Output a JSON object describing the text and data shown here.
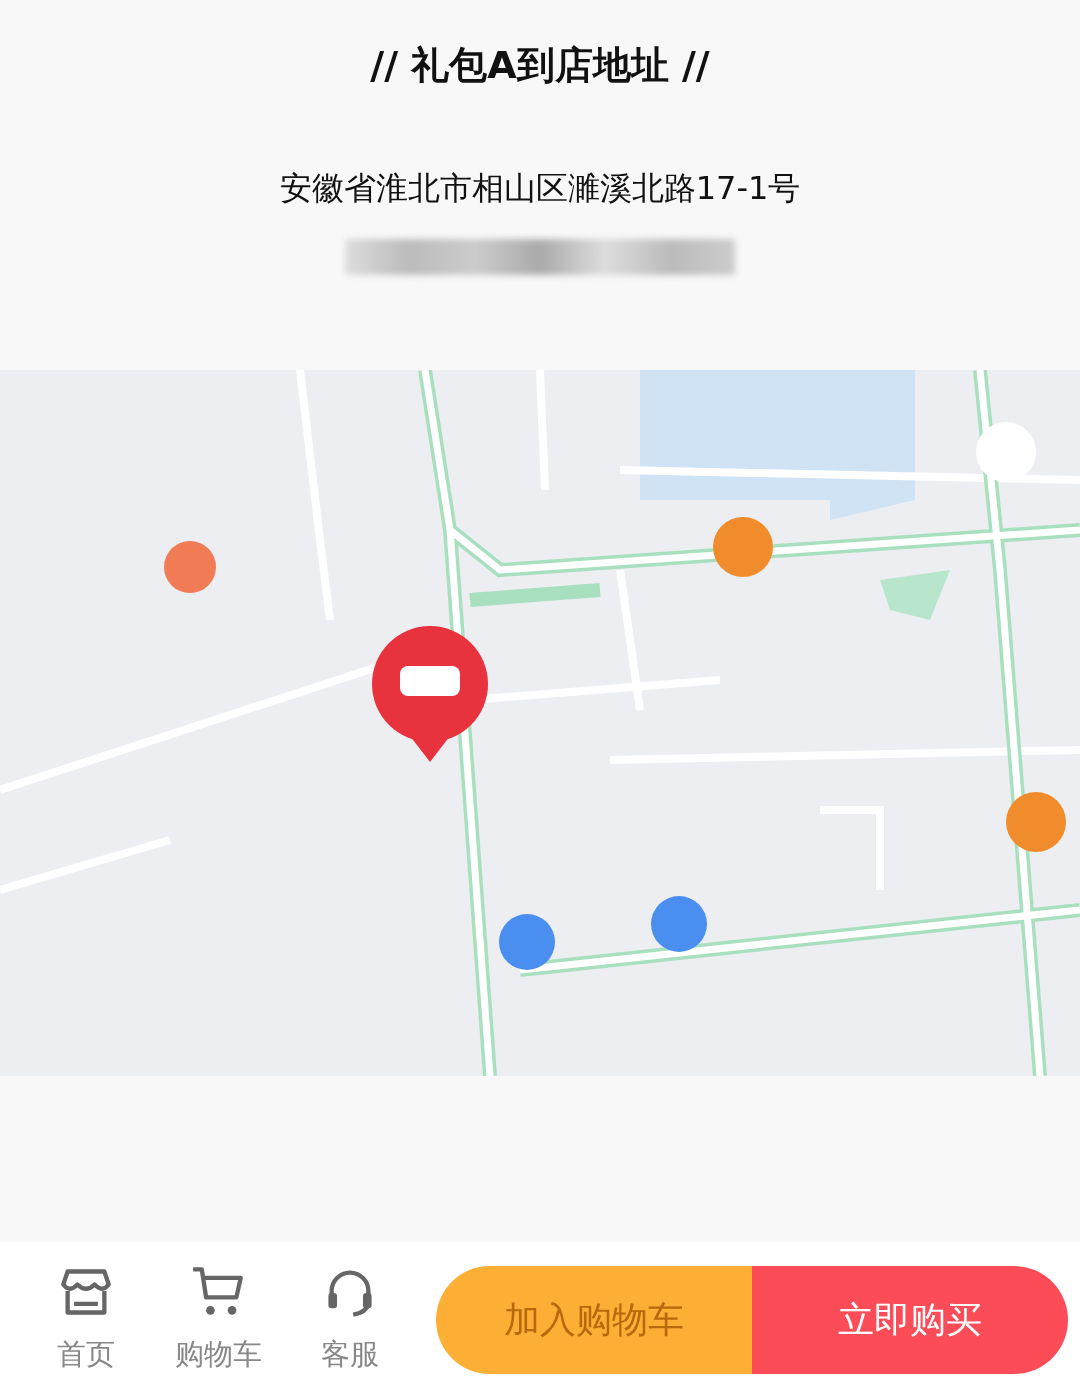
{
  "section": {
    "title": "// 礼包A到店地址 //",
    "address": "安徽省淮北市相山区濉溪北路17-1号"
  },
  "bottom_bar": {
    "nav": [
      {
        "label": "首页"
      },
      {
        "label": "购物车"
      },
      {
        "label": "客服"
      }
    ],
    "actions": [
      {
        "label": "加入购物车",
        "kind": "cart"
      },
      {
        "label": "立即购买",
        "kind": "buy"
      }
    ]
  }
}
